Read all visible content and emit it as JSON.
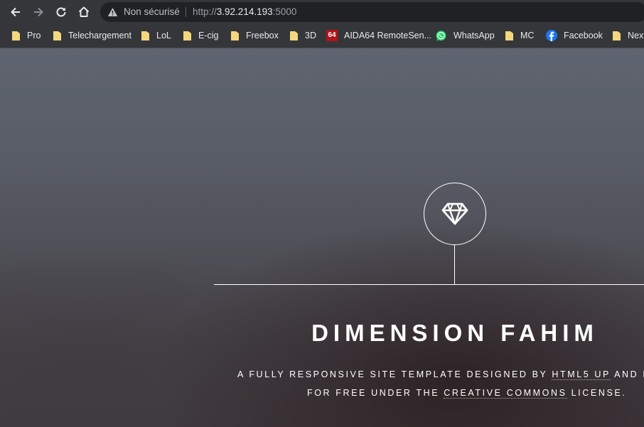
{
  "browser": {
    "security_label": "Non sécurisé",
    "url_scheme": "http://",
    "url_host": "3.92.214.193",
    "url_port": ":5000"
  },
  "bookmarks": [
    {
      "label": "Pro",
      "icon": "folder-icon"
    },
    {
      "label": "Telechargement",
      "icon": "folder-icon"
    },
    {
      "label": "LoL",
      "icon": "folder-icon"
    },
    {
      "label": "E-cig",
      "icon": "folder-icon"
    },
    {
      "label": "Freebox",
      "icon": "folder-icon"
    },
    {
      "label": "3D",
      "icon": "folder-icon"
    },
    {
      "label": "AIDA64 RemoteSen...",
      "icon": "aida64-icon",
      "icon_text": "64"
    },
    {
      "label": "WhatsApp",
      "icon": "whatsapp-icon"
    },
    {
      "label": "MC",
      "icon": "folder-icon"
    },
    {
      "label": "Facebook",
      "icon": "facebook-icon"
    },
    {
      "label": "Next",
      "icon": "folder-icon"
    }
  ],
  "page": {
    "title": "DIMENSION FAHIM",
    "desc_part1": "A fully responsive site template designed by ",
    "link1": "HTML5 UP",
    "desc_part2": " and released",
    "desc_part3": "for free under the ",
    "link2": "Creative Commons",
    "desc_part4": " license."
  },
  "colors": {
    "toolbar_bg": "#35363a",
    "omnibox_bg": "#202124",
    "folder": "#f4d77d",
    "aida_red": "#b3131b",
    "whatsapp": "#25d366",
    "facebook": "#1877f2"
  }
}
